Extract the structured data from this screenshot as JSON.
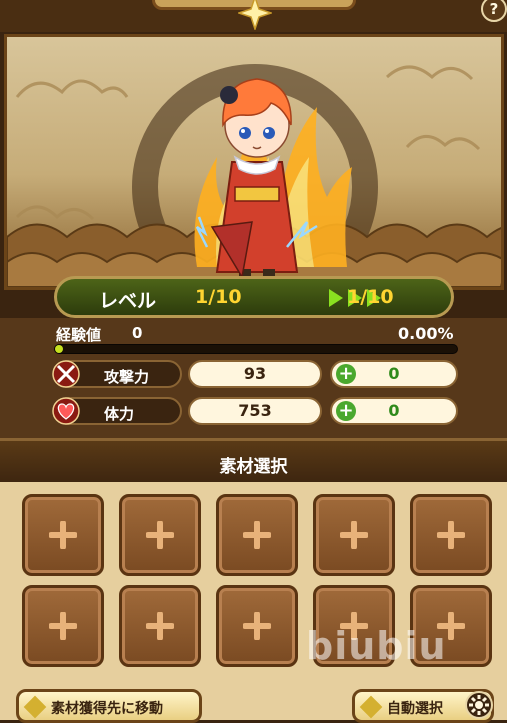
{
  "header": {
    "help_label": "?"
  },
  "level": {
    "label": "レベル",
    "current": "1/10",
    "next": "1/10"
  },
  "exp": {
    "label": "経験値",
    "value": "0",
    "percent": "0.00%",
    "progress": 0
  },
  "stats": [
    {
      "label": "攻撃力",
      "value": "93",
      "bonus": "0",
      "icon": "crossed-swords-icon"
    },
    {
      "label": "体力",
      "value": "753",
      "bonus": "0",
      "icon": "heart-icon"
    }
  ],
  "materials": {
    "title": "素材選択",
    "slot_count": 10
  },
  "buttons": {
    "go_to_source": "素材獲得先に移動",
    "auto_select": "自動選択"
  },
  "watermark": "biubiu",
  "colors": {
    "accent": "#ffd531",
    "bonus": "#4aa82e",
    "panel": "#57381a"
  }
}
